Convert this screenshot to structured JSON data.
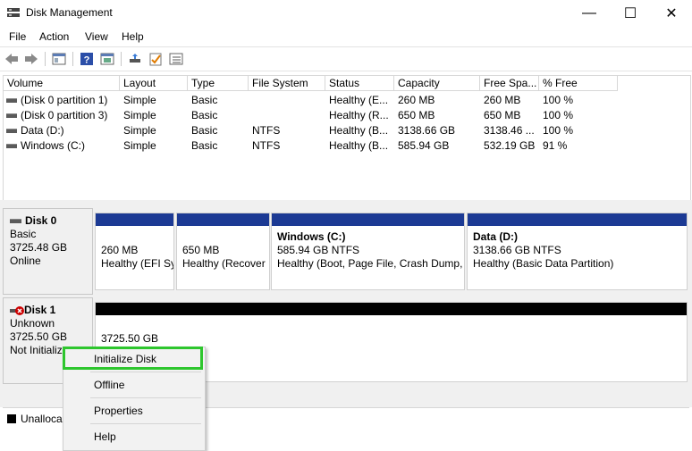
{
  "window": {
    "title": "Disk Management",
    "minimize_glyph": "—",
    "maximize_glyph": "☐",
    "close_glyph": "✕"
  },
  "menu": [
    "File",
    "Action",
    "View",
    "Help"
  ],
  "toolbar_icons": [
    "back-arrow-icon",
    "forward-arrow-icon",
    "console-tree-icon",
    "help-icon",
    "properties-icon",
    "connect-icon",
    "check-icon",
    "list-icon"
  ],
  "volume_table": {
    "headers": [
      "Volume",
      "Layout",
      "Type",
      "File System",
      "Status",
      "Capacity",
      "Free Spa...",
      "% Free"
    ],
    "rows": [
      [
        "(Disk 0 partition 1)",
        "Simple",
        "Basic",
        "",
        "Healthy (E...",
        "260 MB",
        "260 MB",
        "100 %"
      ],
      [
        "(Disk 0 partition 3)",
        "Simple",
        "Basic",
        "",
        "Healthy (R...",
        "650 MB",
        "650 MB",
        "100 %"
      ],
      [
        "Data (D:)",
        "Simple",
        "Basic",
        "NTFS",
        "Healthy (B...",
        "3138.66 GB",
        "3138.46 ...",
        "100 %"
      ],
      [
        "Windows (C:)",
        "Simple",
        "Basic",
        "NTFS",
        "Healthy (B...",
        "585.94 GB",
        "532.19 GB",
        "91 %"
      ]
    ]
  },
  "disk0": {
    "name": "Disk 0",
    "type": "Basic",
    "size": "3725.48 GB",
    "status": "Online",
    "partitions": [
      {
        "name": "",
        "size": "260 MB",
        "status": "Healthy (EFI Sy"
      },
      {
        "name": "",
        "size": "650 MB",
        "status": "Healthy (Recover"
      },
      {
        "name": "Windows  (C:)",
        "size": "585.94 GB NTFS",
        "status": "Healthy (Boot, Page File, Crash Dump,"
      },
      {
        "name": "Data  (D:)",
        "size": "3138.66 GB NTFS",
        "status": "Healthy (Basic Data Partition)"
      }
    ]
  },
  "disk1": {
    "name": "Disk 1",
    "type": "Unknown",
    "size": "3725.50 GB",
    "status": "Not Initializ",
    "unallocated_size": "3725.50 GB"
  },
  "legend": {
    "unallocated": "Unalloca"
  },
  "context_menu": {
    "items": [
      "Initialize Disk",
      "Offline",
      "Properties",
      "Help"
    ],
    "highlight_color": "#2ec62e"
  },
  "colors": {
    "primary_partition": "#1c3a94",
    "unallocated": "#000000"
  }
}
